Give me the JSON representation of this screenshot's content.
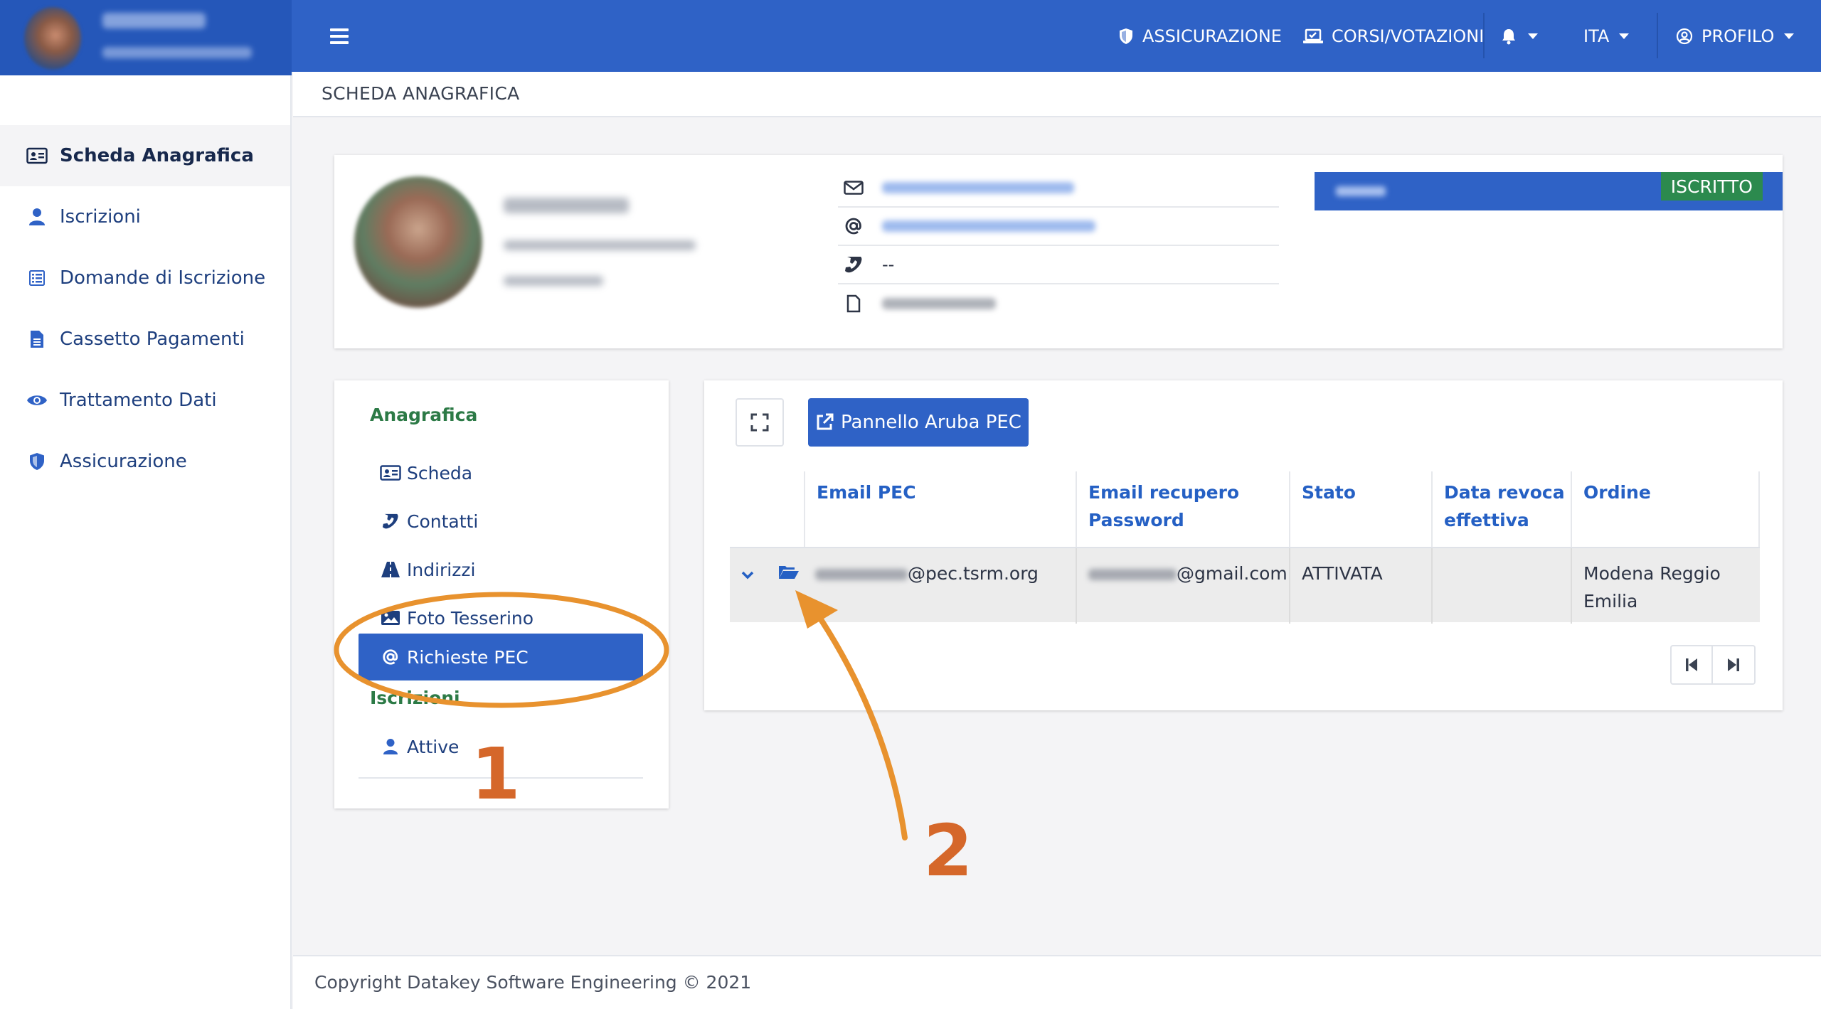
{
  "topbar": {
    "nav": [
      {
        "label": "ASSICURAZIONE",
        "icon": "shield-icon"
      },
      {
        "label": "CORSI/VOTAZIONI",
        "icon": "laptop-check-icon"
      },
      {
        "label": "",
        "icon": "bell-icon"
      },
      {
        "label": "ITA",
        "icon": ""
      },
      {
        "label": "PROFILO",
        "icon": "user-circle-icon"
      }
    ],
    "color": "#2f62c6"
  },
  "sidebar": {
    "items": [
      {
        "label": "Scheda Anagrafica",
        "icon": "id-card-icon",
        "active": true
      },
      {
        "label": "Iscrizioni",
        "icon": "user-icon"
      },
      {
        "label": "Domande di Iscrizione",
        "icon": "form-icon"
      },
      {
        "label": "Cassetto Pagamenti",
        "icon": "document-icon"
      },
      {
        "label": "Trattamento Dati",
        "icon": "eye-icon"
      },
      {
        "label": "Assicurazione",
        "icon": "shield-icon"
      }
    ]
  },
  "breadcrumb": {
    "title": "SCHEDA ANAGRAFICA"
  },
  "profile": {
    "phone": "--",
    "status_badge": "ISCRITTO",
    "status_color": "#2c8a4e"
  },
  "menu": {
    "section_anagrafica": "Anagrafica",
    "items": [
      {
        "label": "Scheda",
        "icon": "id-card-icon"
      },
      {
        "label": "Contatti",
        "icon": "phone-icon"
      },
      {
        "label": "Indirizzi",
        "icon": "road-icon"
      },
      {
        "label": "Foto Tesserino",
        "icon": "image-icon"
      },
      {
        "label": "Richieste PEC",
        "icon": "at-icon",
        "active": true
      }
    ],
    "section_iscrizioni": "Iscrizioni",
    "iscrizioni_items": [
      {
        "label": "Attive",
        "icon": "user-icon"
      }
    ]
  },
  "pec": {
    "aruba_button": "Pannello Aruba PEC",
    "columns": [
      "Email PEC",
      "Email recupero Password",
      "Stato",
      "Data revoca effettiva",
      "Ordine"
    ],
    "row": {
      "email_pec_suffix": "@pec.tsrm.org",
      "email_recovery_suffix": "@gmail.com",
      "stato": "ATTIVATA",
      "data_revoca": "",
      "ordine": "Modena Reggio Emilia"
    }
  },
  "footer": {
    "text": "Copyright Datakey Software Engineering © 2021"
  },
  "annotations": {
    "step1": "1",
    "step2": "2",
    "color": "#e8922e"
  }
}
